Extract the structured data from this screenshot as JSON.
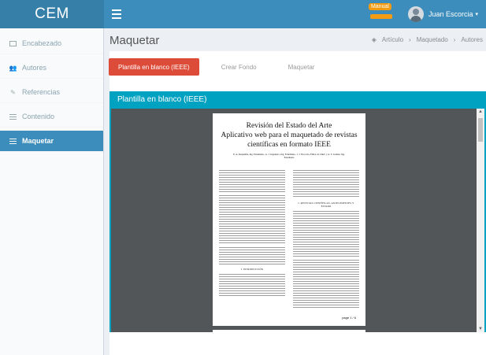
{
  "header": {
    "brand": "CEM",
    "notification_badge": "Manual",
    "user_name": "Juan Escorcia"
  },
  "sidebar": {
    "items": [
      {
        "label": "Encabezado",
        "icon": "window-icon"
      },
      {
        "label": "Autores",
        "icon": "users-icon"
      },
      {
        "label": "Referencias",
        "icon": "edit-icon"
      },
      {
        "label": "Contenido",
        "icon": "list-icon"
      },
      {
        "label": "Maquetar",
        "icon": "list-icon",
        "active": true
      }
    ]
  },
  "page": {
    "title": "Maquetar",
    "breadcrumb": [
      "Artículo",
      "Maquetado",
      "Autores"
    ]
  },
  "tabs": [
    {
      "label": "Plantilla en blanco (IEEE)",
      "active": true
    },
    {
      "label": "Crear Fondo"
    },
    {
      "label": "Maquetar"
    }
  ],
  "viewer": {
    "title": "Plantilla en blanco (IEEE)",
    "document": {
      "title_line1": "Revisión del Estado del Arte",
      "title_line2": "Aplicativo web para el maquetado de revistas",
      "title_line3": "científicas en formato IEEE",
      "authors": "E. A. Requelme, Ing. Estudiante., G. J. Ingeniero, Ing. Estudiante., J. J. Escorcia, Editor en Chief. y A. S. Gómez, Ing. Estudiante",
      "heading_right_1": "I. REVISTAS CIENTÍFICAS, ANTECEDENTES Y ESTADO",
      "heading_left_1": "I. INTRODUCCIÓN",
      "page_label": "page 1 / 6"
    }
  },
  "colors": {
    "topbar": "#3c8dbc",
    "brand_bg": "#367fa9",
    "active_tab": "#dd4b39",
    "viewer_header": "#00a2c1"
  }
}
